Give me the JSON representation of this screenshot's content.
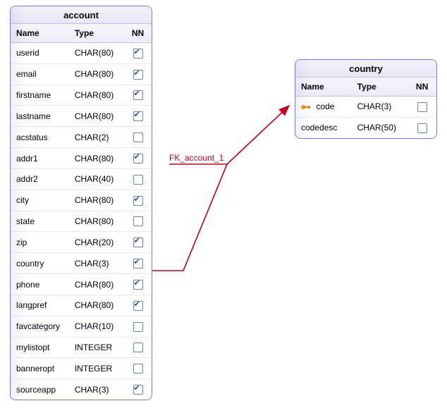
{
  "tables": {
    "account": {
      "title": "account",
      "headers": {
        "name": "Name",
        "type": "Type",
        "nn": "NN"
      },
      "columns": [
        {
          "name": "userid",
          "type": "CHAR(80)",
          "nn": true,
          "pk": false
        },
        {
          "name": "email",
          "type": "CHAR(80)",
          "nn": true,
          "pk": false
        },
        {
          "name": "firstname",
          "type": "CHAR(80)",
          "nn": true,
          "pk": false
        },
        {
          "name": "lastname",
          "type": "CHAR(80)",
          "nn": true,
          "pk": false
        },
        {
          "name": "acstatus",
          "type": "CHAR(2)",
          "nn": false,
          "pk": false
        },
        {
          "name": "addr1",
          "type": "CHAR(80)",
          "nn": true,
          "pk": false
        },
        {
          "name": "addr2",
          "type": "CHAR(40)",
          "nn": false,
          "pk": false
        },
        {
          "name": "city",
          "type": "CHAR(80)",
          "nn": true,
          "pk": false
        },
        {
          "name": "state",
          "type": "CHAR(80)",
          "nn": false,
          "pk": false
        },
        {
          "name": "zip",
          "type": "CHAR(20)",
          "nn": true,
          "pk": false
        },
        {
          "name": "country",
          "type": "CHAR(3)",
          "nn": true,
          "pk": false
        },
        {
          "name": "phone",
          "type": "CHAR(80)",
          "nn": true,
          "pk": false
        },
        {
          "name": "langpref",
          "type": "CHAR(80)",
          "nn": true,
          "pk": false
        },
        {
          "name": "favcategory",
          "type": "CHAR(10)",
          "nn": false,
          "pk": false
        },
        {
          "name": "mylistopt",
          "type": "INTEGER",
          "nn": false,
          "pk": false
        },
        {
          "name": "banneropt",
          "type": "INTEGER",
          "nn": false,
          "pk": false
        },
        {
          "name": "sourceapp",
          "type": "CHAR(3)",
          "nn": true,
          "pk": false
        }
      ]
    },
    "country": {
      "title": "country",
      "headers": {
        "name": "Name",
        "type": "Type",
        "nn": "NN"
      },
      "columns": [
        {
          "name": "code",
          "type": "CHAR(3)",
          "nn": false,
          "pk": true
        },
        {
          "name": "codedesc",
          "type": "CHAR(50)",
          "nn": false,
          "pk": false
        }
      ]
    }
  },
  "relationship": {
    "label": "FK_account_1",
    "from_table": "account",
    "from_column": "country",
    "to_table": "country",
    "to_column": "code",
    "color": "#c00020"
  }
}
